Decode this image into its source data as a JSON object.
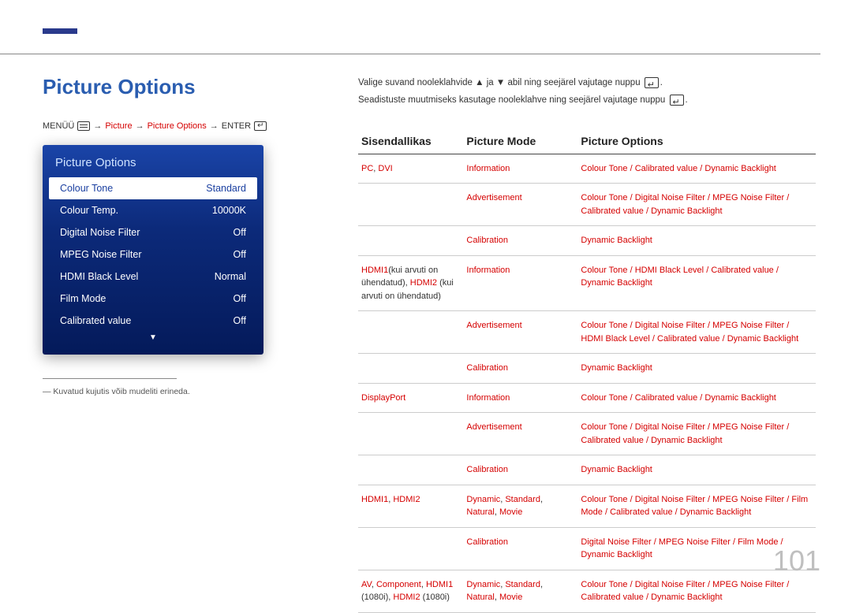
{
  "page_number": "101",
  "title": "Picture Options",
  "breadcrumb": {
    "prefix": "MENÜÜ",
    "picture": "Picture",
    "picture_options": "Picture Options",
    "enter": "ENTER"
  },
  "osd": {
    "title": "Picture Options",
    "rows": [
      {
        "label": "Colour Tone",
        "value": "Standard",
        "selected": true
      },
      {
        "label": "Colour Temp.",
        "value": "10000K"
      },
      {
        "label": "Digital Noise Filter",
        "value": "Off"
      },
      {
        "label": "MPEG Noise Filter",
        "value": "Off"
      },
      {
        "label": "HDMI Black Level",
        "value": "Normal"
      },
      {
        "label": "Film Mode",
        "value": "Off"
      },
      {
        "label": "Calibrated value",
        "value": "Off"
      }
    ]
  },
  "footnote": "Kuvatud kujutis võib mudeliti erineda.",
  "intro": {
    "line1_a": "Valige suvand nooleklahvide ",
    "line1_b": " ja ",
    "line1_c": " abil ning seejärel vajutage nuppu ",
    "line1_d": ".",
    "line2_a": "Seadistuste muutmiseks kasutage nooleklahve ning seejärel vajutage nuppu ",
    "line2_b": "."
  },
  "table": {
    "head": {
      "c1": "Sisendallikas",
      "c2": "Picture Mode",
      "c3": "Picture Options"
    },
    "rows": [
      {
        "c1_html": "<span class='red'>PC</span>, <span class='red'>DVI</span>",
        "c2_html": "<span class='red'>Information</span>",
        "c3_html": "<span class='red'>Colour Tone</span> <span class='slash'>/</span> <span class='red'>Calibrated value</span> <span class='slash'>/</span> <span class='red'>Dynamic Backlight</span>",
        "group_first": true
      },
      {
        "c1_html": "",
        "c2_html": "<span class='red'>Advertisement</span>",
        "c3_html": "<span class='red'>Colour Tone</span> <span class='slash'>/</span> <span class='red'>Digital Noise Filter</span> <span class='slash'>/</span> <span class='red'>MPEG Noise Filter</span> <span class='slash'>/</span> <span class='red'>Calibrated value</span> <span class='slash'>/</span> <span class='red'>Dynamic Backlight</span>"
      },
      {
        "c1_html": "",
        "c2_html": "<span class='red'>Calibration</span>",
        "c3_html": "<span class='red'>Dynamic Backlight</span>"
      },
      {
        "c1_html": "<span class='red'>HDMI1</span><span class='plain'>(kui arvuti on ühendatud),</span> <span class='red'>HDMI2</span> <span class='plain'>(kui arvuti on ühendatud)</span>",
        "c2_html": "<span class='red'>Information</span>",
        "c3_html": "<span class='red'>Colour Tone</span> <span class='slash'>/</span> <span class='red'>HDMI Black Level</span> <span class='slash'>/</span> <span class='red'>Calibrated value</span> <span class='slash'>/</span> <span class='red'>Dynamic Backlight</span>",
        "group_first": true
      },
      {
        "c1_html": "",
        "c2_html": "<span class='red'>Advertisement</span>",
        "c3_html": "<span class='red'>Colour Tone</span> <span class='slash'>/</span> <span class='red'>Digital Noise Filter</span> <span class='slash'>/</span> <span class='red'>MPEG Noise Filter</span> <span class='slash'>/</span> <span class='red'>HDMI Black Level</span> <span class='slash'>/</span> <span class='red'>Calibrated value</span> <span class='slash'>/</span> <span class='red'>Dynamic Backlight</span>"
      },
      {
        "c1_html": "",
        "c2_html": "<span class='red'>Calibration</span>",
        "c3_html": "<span class='red'>Dynamic Backlight</span>"
      },
      {
        "c1_html": "<span class='red'>DisplayPort</span>",
        "c2_html": "<span class='red'>Information</span>",
        "c3_html": "<span class='red'>Colour Tone</span> <span class='slash'>/</span> <span class='red'>Calibrated value</span> <span class='slash'>/</span> <span class='red'>Dynamic Backlight</span>",
        "group_first": true
      },
      {
        "c1_html": "",
        "c2_html": "<span class='red'>Advertisement</span>",
        "c3_html": "<span class='red'>Colour Tone</span> <span class='slash'>/</span> <span class='red'>Digital Noise Filter</span> <span class='slash'>/</span> <span class='red'>MPEG Noise Filter</span> <span class='slash'>/</span> <span class='red'>Calibrated value</span> <span class='slash'>/</span> <span class='red'>Dynamic Backlight</span>"
      },
      {
        "c1_html": "",
        "c2_html": "<span class='red'>Calibration</span>",
        "c3_html": "<span class='red'>Dynamic Backlight</span>"
      },
      {
        "c1_html": "<span class='red'>HDMI1</span>, <span class='red'>HDMI2</span>",
        "c2_html": "<span class='red'>Dynamic</span>, <span class='red'>Standard</span>, <span class='red'>Natural</span>, <span class='red'>Movie</span>",
        "c3_html": "<span class='red'>Colour Tone</span> <span class='slash'>/</span> <span class='red'>Digital Noise Filter</span> <span class='slash'>/</span> <span class='red'>MPEG Noise Filter</span> <span class='slash'>/</span> <span class='red'>Film Mode</span> <span class='slash'>/</span> <span class='red'>Calibrated value</span> <span class='slash'>/</span> <span class='red'>Dynamic Backlight</span>",
        "group_first": true
      },
      {
        "c1_html": "",
        "c2_html": "<span class='red'>Calibration</span>",
        "c3_html": "<span class='red'>Digital Noise Filter</span> <span class='slash'>/</span> <span class='red'>MPEG Noise Filter</span> <span class='slash'>/</span> <span class='red'>Film Mode</span> <span class='slash'>/</span> <span class='red'>Dynamic Backlight</span>"
      },
      {
        "c1_html": "<span class='red'>AV</span>, <span class='red'>Component</span>, <span class='red'>HDMI1</span> <span class='plain'>(1080i)</span>, <span class='red'>HDMI2</span> <span class='plain'>(1080i)</span>",
        "c2_html": "<span class='red'>Dynamic</span>, <span class='red'>Standard</span>, <span class='red'>Natural</span>, <span class='red'>Movie</span>",
        "c3_html": "<span class='red'>Colour Tone</span> <span class='slash'>/</span> <span class='red'>Digital Noise Filter</span> <span class='slash'>/</span> <span class='red'>MPEG Noise Filter</span> <span class='slash'>/</span> <span class='red'>Calibrated value</span> <span class='slash'>/</span> <span class='red'>Dynamic Backlight</span>",
        "group_first": true
      }
    ]
  }
}
